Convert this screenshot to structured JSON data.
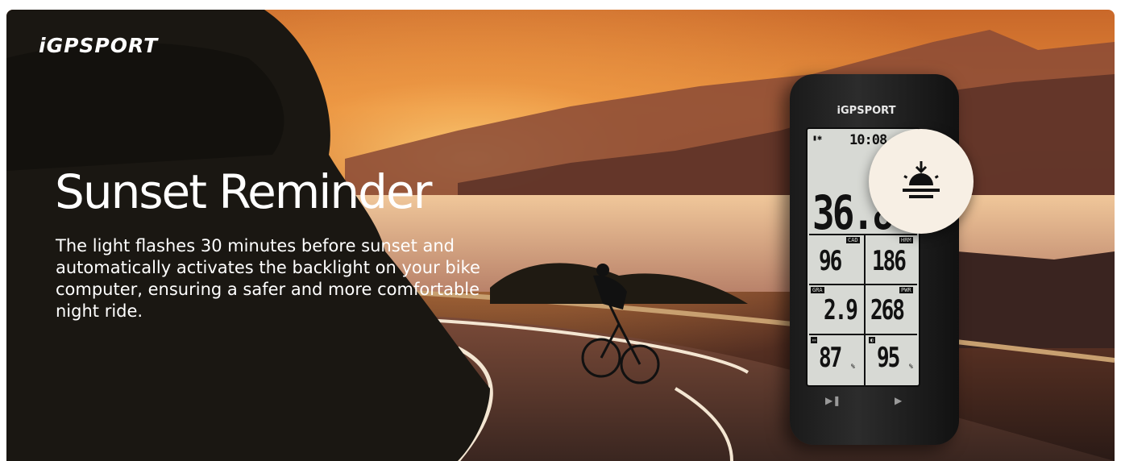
{
  "brand": {
    "logo": "iGPSPORT"
  },
  "hero": {
    "title": "Sunset Reminder",
    "description": "The light flashes 30 minutes before sunset and automatically activates the backlight on your bike computer, ensuring a safer and more comfortable night ride."
  },
  "device": {
    "brand": "iGPSPORT",
    "screen": {
      "time": "10:08",
      "speed": "36.8",
      "fields": [
        {
          "label": "CAD",
          "value": "96"
        },
        {
          "label": "HRM",
          "value": "186"
        },
        {
          "label": "GRA",
          "value": "2.9"
        },
        {
          "label": "PWR",
          "value": "268"
        },
        {
          "label": "",
          "value": "87",
          "unit": "%"
        },
        {
          "label": "",
          "value": "95",
          "unit": "%"
        }
      ]
    },
    "buttons": {
      "play_pause_icon": "play-pause-icon",
      "next_icon": "chevron-right-icon"
    }
  },
  "callout": {
    "icon": "sunset-icon"
  },
  "colors": {
    "sky": "#e38a3a",
    "callout_bg": "#f7efe4",
    "screen_bg": "#d7d9d4"
  }
}
